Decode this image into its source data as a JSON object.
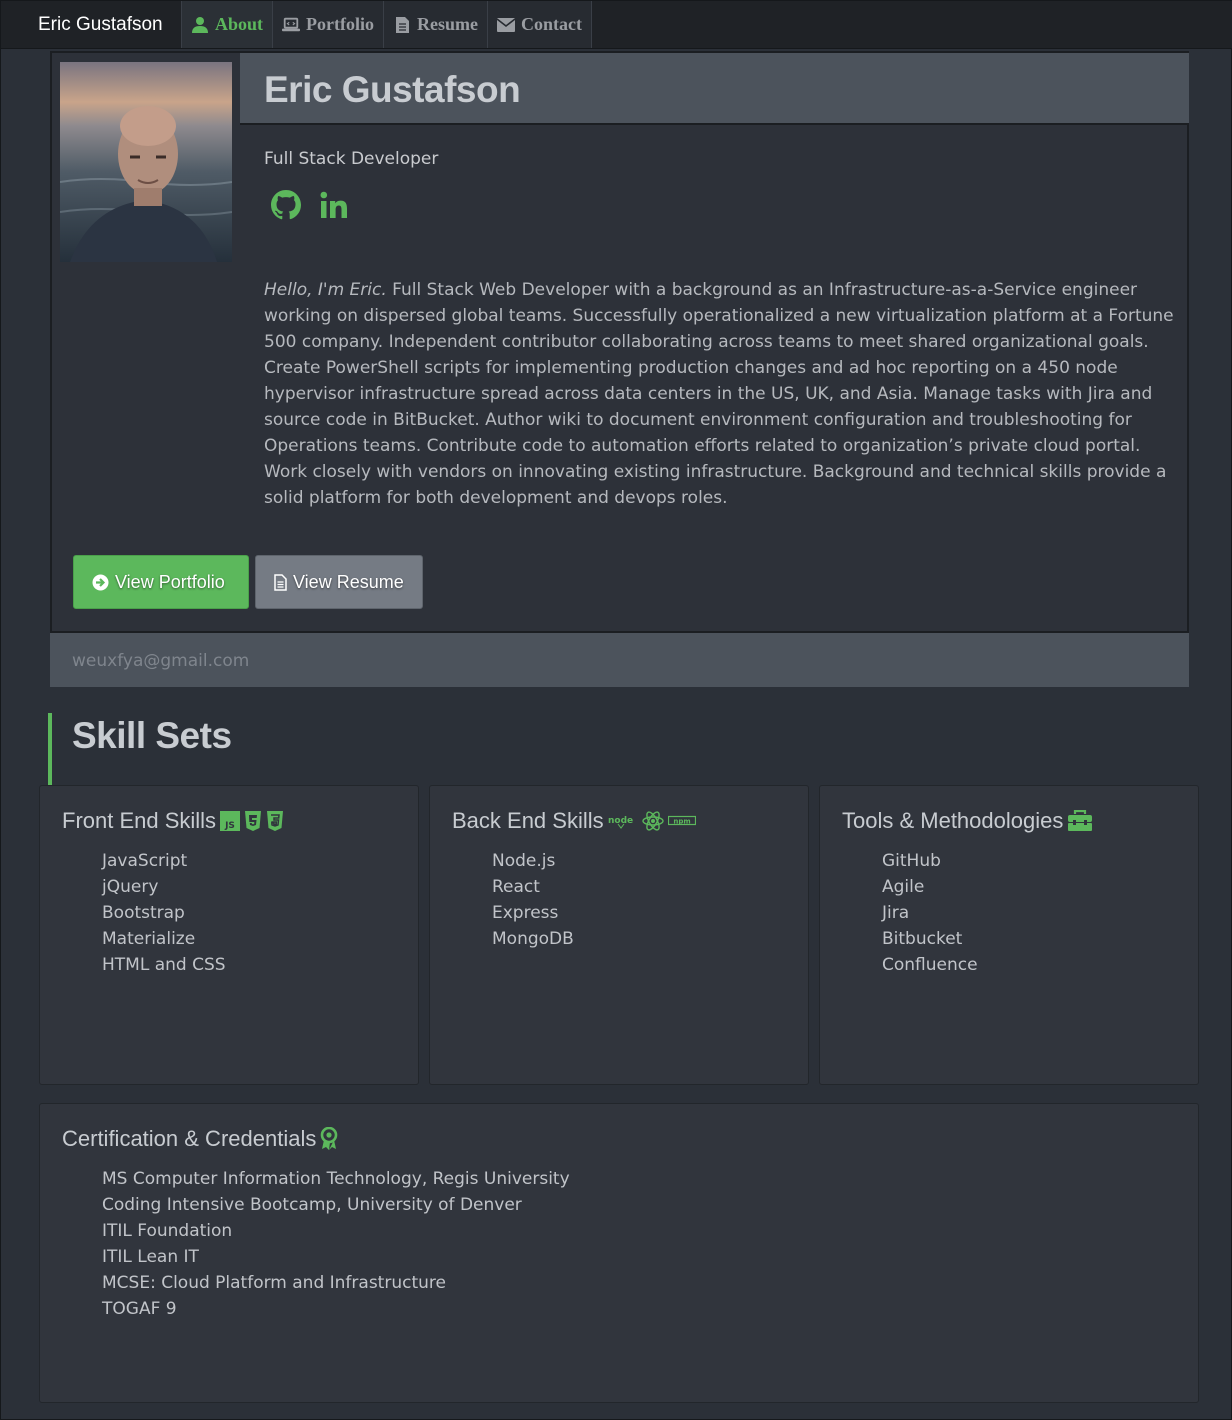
{
  "navbar": {
    "brand": "Eric Gustafson",
    "items": [
      {
        "label": "About",
        "icon": "user-icon",
        "active": true
      },
      {
        "label": "Portfolio",
        "icon": "laptop-icon",
        "active": false
      },
      {
        "label": "Resume",
        "icon": "file-icon",
        "active": false
      },
      {
        "label": "Contact",
        "icon": "envelope-icon",
        "active": false
      }
    ]
  },
  "profile": {
    "name": "Eric Gustafson",
    "title": "Full Stack Developer",
    "socials": [
      "github-icon",
      "linkedin-icon"
    ],
    "bio_intro": "Hello, I'm Eric.",
    "bio_text": " Full Stack Web Developer with a background as an Infrastructure-as-a-Service engineer working on dispersed global teams. Successfully operationalized a new virtualization platform at a Fortune 500 company. Independent contributor collaborating across teams to meet shared organizational goals. Create PowerShell scripts for implementing production changes and ad hoc reporting on a 450 node hypervisor infrastructure spread across data centers in the US, UK, and Asia. Manage tasks with Jira and source code in BitBucket. Author wiki to document environment configuration and troubleshooting for Operations teams. Contribute code to automation efforts related to organization’s private cloud portal. Work closely with vendors on innovating existing infrastructure. Background and technical skills provide a solid platform for both development and devops roles.",
    "buttons": {
      "portfolio": "View Portfolio",
      "resume": "View Resume"
    },
    "email": "weuxfya@gmail.com"
  },
  "skills": {
    "heading": "Skill Sets",
    "front_end": {
      "title": "Front End Skills",
      "icons": [
        "js-icon",
        "html5-icon",
        "css3-icon"
      ],
      "items": [
        "JavaScript",
        "jQuery",
        "Bootstrap",
        "Materialize",
        "HTML and CSS"
      ]
    },
    "back_end": {
      "title": "Back End Skills",
      "icons": [
        "node-icon",
        "react-icon",
        "npm-icon"
      ],
      "items": [
        "Node.js",
        "React",
        "Express",
        "MongoDB"
      ]
    },
    "tools": {
      "title": "Tools & Methodologies",
      "icons": [
        "toolbox-icon"
      ],
      "items": [
        "GitHub",
        "Agile",
        "Jira",
        "Bitbucket",
        "Confluence"
      ]
    },
    "certs": {
      "title": "Certification & Credentials",
      "icons": [
        "award-icon"
      ],
      "items": [
        "MS Computer Information Technology, Regis University",
        "Coding Intensive Bootcamp, University of Denver",
        "ITIL Foundation",
        "ITIL Lean IT",
        "MCSE: Cloud Platform and Infrastructure",
        "TOGAF 9"
      ]
    }
  },
  "colors": {
    "accent": "#5cb85c",
    "background": "#2b3038",
    "navbar": "#1f2226",
    "header_bar": "#4c535c"
  }
}
